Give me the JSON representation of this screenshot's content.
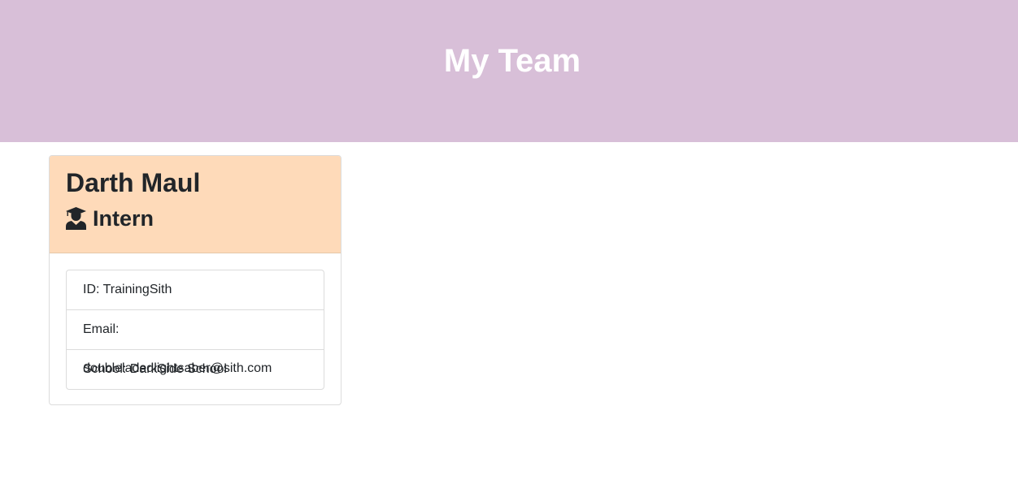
{
  "header": {
    "title": "My Team"
  },
  "card": {
    "name": "Darth Maul",
    "role": "Intern",
    "role_icon": "graduate-icon",
    "details": [
      {
        "label": "ID: ",
        "value": "TrainingSith"
      },
      {
        "label": "Email: ",
        "value": "doubleladedlightsaber@sith.com"
      },
      {
        "label": "School: ",
        "value": "DarkSide School"
      }
    ]
  },
  "colors": {
    "header_bg": "#d8bfd8",
    "card_header_bg": "#fedab9"
  }
}
